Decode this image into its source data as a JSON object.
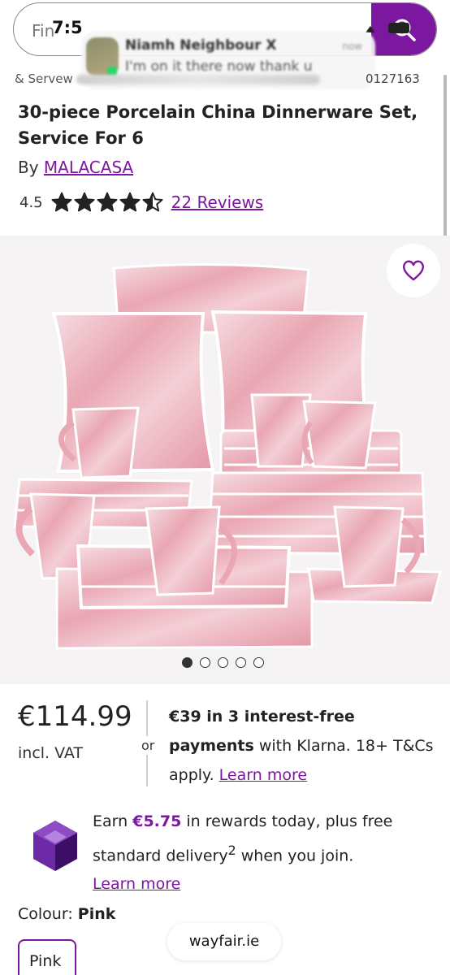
{
  "status_bar": {
    "time": "7:5"
  },
  "search": {
    "placeholder": "Fin"
  },
  "notification": {
    "sender": "Niamh Neighbour X",
    "message": "I'm on it there now thank u",
    "time": "now"
  },
  "breadcrumb": {
    "start": "& Servew",
    "sku": "0127163"
  },
  "product": {
    "title": "30-piece Porcelain China Dinnerware Set, Service For 6",
    "by_label": "By",
    "brand": "MALACASA",
    "rating": "4.5",
    "rating_value": 4.5,
    "rating_max": 5,
    "reviews": "22 Reviews"
  },
  "gallery": {
    "image_count": 5,
    "active_index": 0
  },
  "pricing": {
    "price": "€114.99",
    "vat": "incl. VAT",
    "or": "or",
    "klarna_bold1": "€39 in 3 interest-free",
    "klarna_bold2": "payments",
    "klarna_text": " with Klarna. 18+ T&Cs apply. ",
    "klarna_link": "Learn more"
  },
  "rewards": {
    "pre": "Earn ",
    "amount": "€5.75",
    "post": " in rewards today, plus free standard delivery",
    "sup": "2",
    "post2": " when you join.",
    "link": "Learn more"
  },
  "colour": {
    "label": "Colour:",
    "value": "Pink",
    "swatch": "Pink"
  },
  "browser": {
    "domain": "wayfair.ie"
  },
  "colors": {
    "accent": "#7b189f",
    "text": "#222222",
    "pink": "#e9a6b3"
  }
}
